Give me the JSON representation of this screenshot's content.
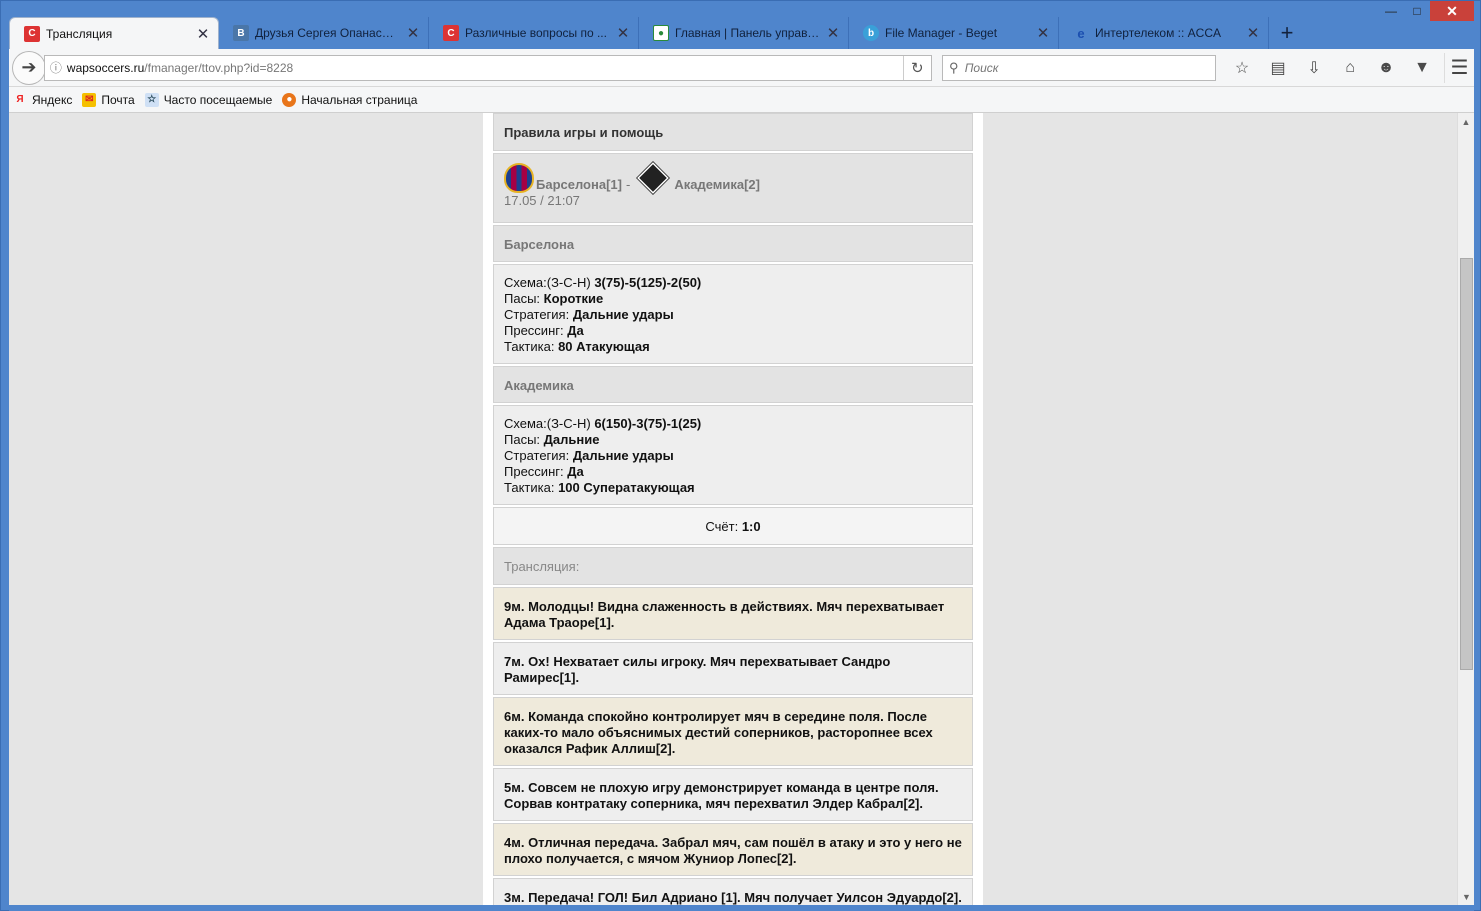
{
  "browser": {
    "tabs": [
      {
        "title": "Трансляция",
        "icon": "cms-icon",
        "active": true
      },
      {
        "title": "Друзья Сергея Опанасен...",
        "icon": "vk-icon",
        "active": false
      },
      {
        "title": "Различные вопросы по ...",
        "icon": "cms-icon",
        "active": false
      },
      {
        "title": "Главная | Панель управл...",
        "icon": "panel-icon",
        "active": false
      },
      {
        "title": "File Manager - Beget",
        "icon": "beget-icon",
        "active": false
      },
      {
        "title": "Интертелеком :: ACCA",
        "icon": "ie-icon",
        "active": false
      }
    ],
    "url_host": "wapsoccers.ru",
    "url_path": "/fmanager/ttov.php?id=8228",
    "search_placeholder": "Поиск",
    "bookmarks": [
      {
        "label": "Яндекс",
        "icon": "yandex-icon"
      },
      {
        "label": "Почта",
        "icon": "mail-icon"
      },
      {
        "label": "Часто посещаемые",
        "icon": "frequent-icon"
      },
      {
        "label": "Начальная страница",
        "icon": "firefox-icon"
      }
    ]
  },
  "page": {
    "header": "Правила игры и помощь",
    "match": {
      "home": "Барселона[1]",
      "separator": "-",
      "away": "Академика[2]",
      "datetime": "17.05 / 21:07"
    },
    "team1": {
      "name": "Барселона",
      "scheme_label": "Схема:(З-С-Н)",
      "scheme_value": "3(75)-5(125)-2(50)",
      "passes_label": "Пасы:",
      "passes_value": "Короткие",
      "strategy_label": "Стратегия:",
      "strategy_value": "Дальние удары",
      "pressing_label": "Прессинг:",
      "pressing_value": "Да",
      "tactic_label": "Тактика:",
      "tactic_value": "80 Атакующая"
    },
    "team2": {
      "name": "Академика",
      "scheme_label": "Схема:(З-С-Н)",
      "scheme_value": "6(150)-3(75)-1(25)",
      "passes_label": "Пасы:",
      "passes_value": "Дальние",
      "strategy_label": "Стратегия:",
      "strategy_value": "Дальние удары",
      "pressing_label": "Прессинг:",
      "pressing_value": "Да",
      "tactic_label": "Тактика:",
      "tactic_value": "100 Суператакующая"
    },
    "score_label": "Счёт:",
    "score_value": "1:0",
    "translation_label": "Трансляция:",
    "events": [
      "9м. Молодцы! Видна слаженность в действиях. Мяч перехватывает Адама Траоре[1].",
      "7м. Ох! Нехватает силы игроку. Мяч перехватывает Сандро Рамирес[1].",
      "6м. Команда спокойно контролирует мяч в середине поля. После каких-то мало объяснимых дестий соперников, расторопнее всех оказался Рафик Аллиш[2].",
      "5м. Совсем не плохую игру демонстрирует команда в центре поля. Сорвав контратаку соперника, мяч перехватил Элдер Кабрал[2].",
      "4м. Отличная передача. Забрал мяч, сам пошёл в атаку и это у него не плохо получается, с мячом Жуниор Лопес[2].",
      "3м. Передача! ГОЛ! Бил Адриано [1]. Мяч получает Уилсон Эдуардо[2]."
    ]
  }
}
